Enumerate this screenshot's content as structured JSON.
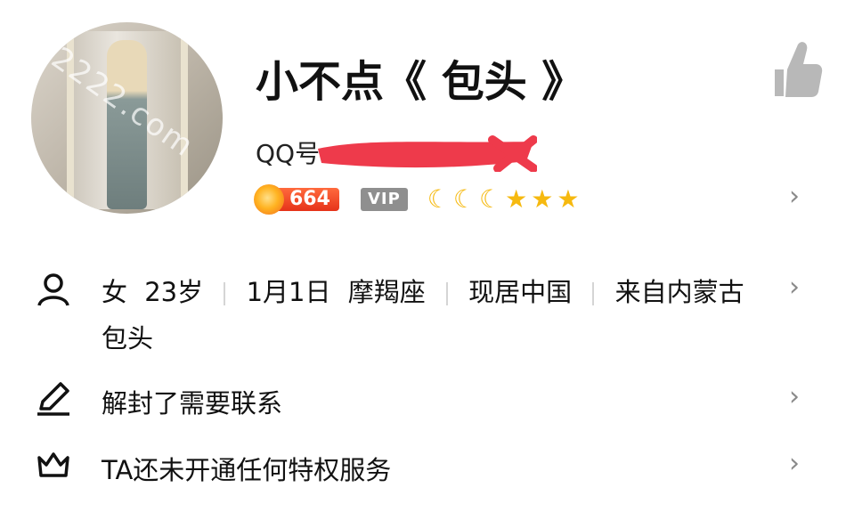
{
  "profile": {
    "name": "小不点《 包头 》",
    "qq_label": "QQ号",
    "level": "664",
    "vip": "VIP",
    "rank_icons": [
      "moon",
      "moon",
      "moon",
      "star",
      "star",
      "star"
    ]
  },
  "info": {
    "gender": "女",
    "age": "23岁",
    "birthday": "1月1日",
    "zodiac": "摩羯座",
    "location": "现居中国",
    "hometown": "来自内蒙古",
    "hometown_cont": "包头"
  },
  "signature": "解封了需要联系",
  "privilege": "TA还未开通任何特权服务",
  "avatar_watermark": "2222.com",
  "colors": {
    "accent_orange": "#f26b1d",
    "vip_gray": "#8f8f8f",
    "star_gold": "#f6b90f",
    "redact": "#ee3a4b"
  }
}
